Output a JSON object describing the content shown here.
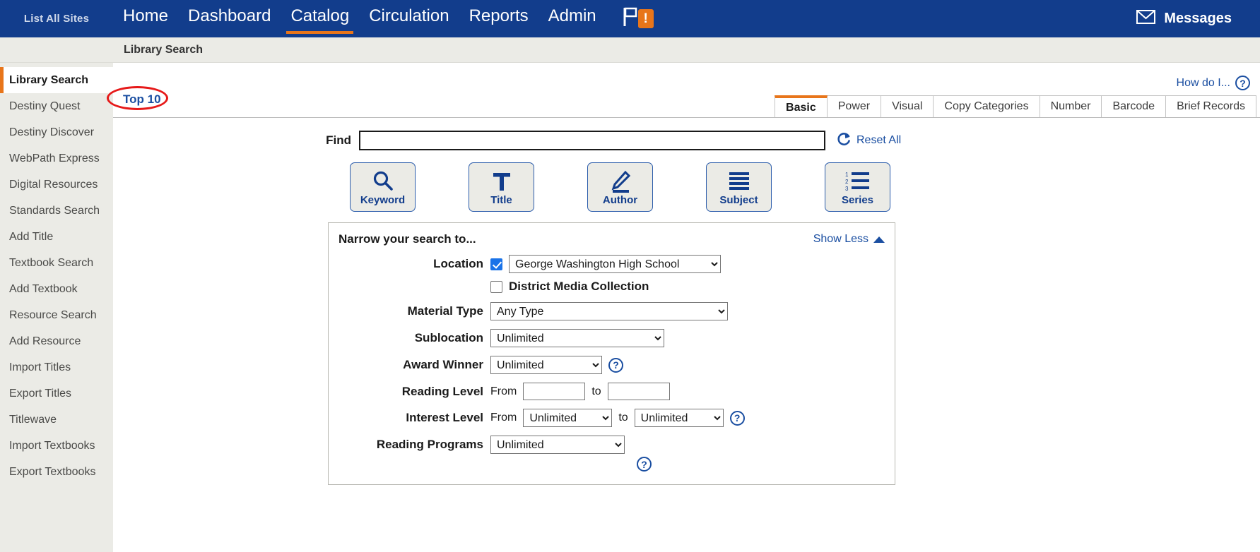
{
  "topnav": {
    "list_all_sites": "List All Sites",
    "items": [
      {
        "label": "Home",
        "active": false
      },
      {
        "label": "Dashboard",
        "active": false
      },
      {
        "label": "Catalog",
        "active": true
      },
      {
        "label": "Circulation",
        "active": false
      },
      {
        "label": "Reports",
        "active": false
      },
      {
        "label": "Admin",
        "active": false
      }
    ],
    "flag_badge": "!",
    "messages_label": "Messages",
    "bg_color": "#123D8C",
    "accent_color": "#E8751A"
  },
  "breadcrumb": {
    "text": "Library Search"
  },
  "sidebar": {
    "items": [
      {
        "label": "Library Search",
        "active": true
      },
      {
        "label": "Destiny Quest",
        "active": false
      },
      {
        "label": "Destiny Discover",
        "active": false
      },
      {
        "label": "WebPath Express",
        "active": false
      },
      {
        "label": "Digital Resources",
        "active": false
      },
      {
        "label": "Standards Search",
        "active": false
      },
      {
        "label": "Add Title",
        "active": false
      },
      {
        "label": "Textbook Search",
        "active": false
      },
      {
        "label": "Add Textbook",
        "active": false
      },
      {
        "label": "Resource Search",
        "active": false
      },
      {
        "label": "Add Resource",
        "active": false
      },
      {
        "label": "Import Titles",
        "active": false
      },
      {
        "label": "Export Titles",
        "active": false
      },
      {
        "label": "Titlewave",
        "active": false
      },
      {
        "label": "Import Textbooks",
        "active": false
      },
      {
        "label": "Export Textbooks",
        "active": false
      }
    ]
  },
  "content": {
    "how_do_i": "How do I...",
    "top10": "Top 10",
    "tabs": [
      {
        "label": "Basic",
        "active": true
      },
      {
        "label": "Power",
        "active": false
      },
      {
        "label": "Visual",
        "active": false
      },
      {
        "label": "Copy Categories",
        "active": false
      },
      {
        "label": "Number",
        "active": false
      },
      {
        "label": "Barcode",
        "active": false
      },
      {
        "label": "Brief Records",
        "active": false
      }
    ],
    "find": {
      "label": "Find",
      "value": "",
      "placeholder": ""
    },
    "reset_all": "Reset All",
    "search_buttons": [
      {
        "label": "Keyword",
        "icon": "magnifier-icon"
      },
      {
        "label": "Title",
        "icon": "letter-t-icon"
      },
      {
        "label": "Author",
        "icon": "pencil-icon"
      },
      {
        "label": "Subject",
        "icon": "lines-icon"
      },
      {
        "label": "Series",
        "icon": "numbered-list-icon"
      }
    ],
    "narrow": {
      "title": "Narrow your search to...",
      "show_less": "Show Less",
      "location": {
        "label": "Location",
        "checked": true,
        "value": "George Washington High School"
      },
      "district_media": {
        "label": "District Media Collection",
        "checked": false
      },
      "material_type": {
        "label": "Material Type",
        "value": "Any Type"
      },
      "sublocation": {
        "label": "Sublocation",
        "value": "Unlimited"
      },
      "award_winner": {
        "label": "Award Winner",
        "value": "Unlimited"
      },
      "reading_level": {
        "label": "Reading Level",
        "from_word": "From",
        "to_word": "to",
        "from": "",
        "to": ""
      },
      "interest_level": {
        "label": "Interest Level",
        "from_word": "From",
        "to_word": "to",
        "from": "Unlimited",
        "to": "Unlimited"
      },
      "reading_programs": {
        "label": "Reading Programs",
        "value": "Unlimited"
      }
    }
  }
}
